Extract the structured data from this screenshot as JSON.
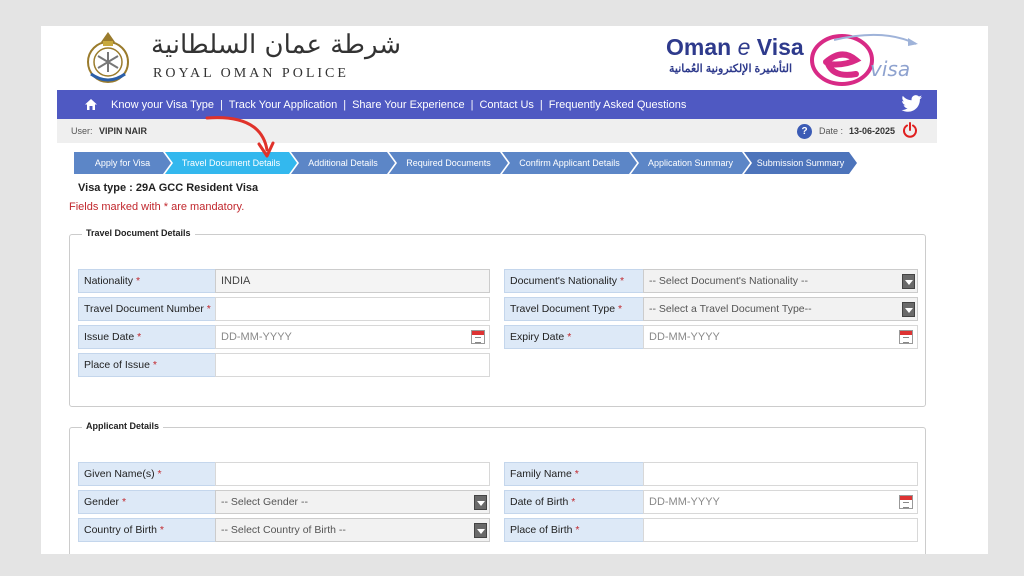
{
  "header": {
    "rop_arabic": "شرطة عمان السلطانية",
    "rop_english": "ROYAL OMAN POLICE",
    "evisa_title_a": "Oman ",
    "evisa_title_e": "e",
    "evisa_title_b": " Visa",
    "evisa_arabic": "التأشيرة الإلكترونية العُمانية",
    "evisa_logo_text": "visa",
    "brand_color": "#4f59c2"
  },
  "nav": {
    "items": [
      {
        "label": "Know your Visa Type"
      },
      {
        "label": "Track Your Application"
      },
      {
        "label": "Share Your Experience"
      },
      {
        "label": "Contact Us"
      },
      {
        "label": "Frequently Asked Questions"
      }
    ],
    "separator": "|",
    "home_icon": "home-icon",
    "social_icon": "twitter-icon"
  },
  "userbar": {
    "user_label": "User:",
    "user_name": "VIPIN  NAIR",
    "help": "?",
    "date_label": "Date :",
    "date_value": "13-06-2025"
  },
  "steps": [
    {
      "label": "Apply for Visa",
      "state": "done"
    },
    {
      "label": "Travel Document Details",
      "state": "active"
    },
    {
      "label": "Additional Details",
      "state": "pending"
    },
    {
      "label": "Required Documents",
      "state": "pending"
    },
    {
      "label": "Confirm Applicant Details",
      "state": "pending"
    },
    {
      "label": "Application Summary",
      "state": "pending"
    },
    {
      "label": "Submission Summary",
      "state": "pending"
    }
  ],
  "visa_type": "Visa type   : 29A GCC Resident Visa",
  "mandatory_note": "Fields marked with * are mandatory.",
  "travel_doc": {
    "title": "Travel Document Details",
    "nationality_label": "Nationality",
    "nationality_value": "INDIA",
    "doc_nationality_label": "Document's Nationality",
    "doc_nationality_value": "-- Select Document's Nationality --",
    "doc_number_label": "Travel Document Number",
    "doc_number_value": "",
    "doc_type_label": "Travel Document Type",
    "doc_type_value": "-- Select a Travel Document Type--",
    "issue_date_label": "Issue Date",
    "issue_date_placeholder": "DD-MM-YYYY",
    "expiry_date_label": "Expiry Date",
    "expiry_date_placeholder": "DD-MM-YYYY",
    "place_issue_label": "Place of Issue",
    "place_issue_value": ""
  },
  "applicant": {
    "title": "Applicant Details",
    "given_name_label": "Given Name(s)",
    "given_name_value": "",
    "family_name_label": "Family Name",
    "family_name_value": "",
    "gender_label": "Gender",
    "gender_value": "-- Select Gender --",
    "dob_label": "Date of Birth",
    "dob_placeholder": "DD-MM-YYYY",
    "country_birth_label": "Country of Birth",
    "country_birth_value": "-- Select Country of Birth --",
    "place_birth_label": "Place of Birth",
    "place_birth_value": ""
  },
  "required_mark": "*"
}
